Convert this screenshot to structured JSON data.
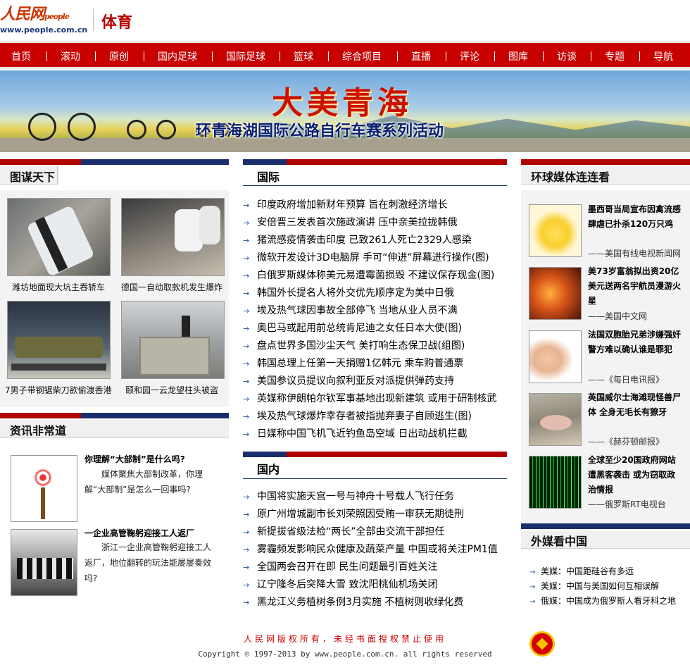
{
  "header": {
    "logo_text": "人民网",
    "logo_small": "people",
    "logo_url": "www.people.com.cn",
    "section_title": "体育"
  },
  "nav": [
    "首页",
    "滚动",
    "原创",
    "国内足球",
    "国际足球",
    "篮球",
    "综合项目",
    "直播",
    "评论",
    "图库",
    "访谈",
    "专题",
    "导航"
  ],
  "banner": {
    "title": "大美青海",
    "subtitle": "环青海湖国际公路自行车赛系列活动"
  },
  "left": {
    "tumou_heading": "图谋天下",
    "photos": [
      {
        "caption": "潍坊地面现大坑主吞轿车"
      },
      {
        "caption": "德国一自动取款机发生爆炸"
      },
      {
        "caption": "7男子带钢锯柴刀欲偷渡香港"
      },
      {
        "caption": "颐和园一云龙望柱头被盗"
      }
    ],
    "zixun_heading": "资讯非常道",
    "zixun": [
      {
        "title": "你理解“大部制”是什么吗?",
        "body": "媒体聚焦大部制改革，你理解“大部制”是怎么一回事吗?"
      },
      {
        "title": "一企业高管鞠躬迎接工人返厂",
        "body": "浙江一企业高管鞠躬迎接工人返厂，地位翻转的玩法能屡屡奏效吗?"
      }
    ]
  },
  "middle": {
    "guoji_heading": "国际",
    "guoji": [
      "印度政府增加新财年预算 旨在刺激经济增长",
      "安倍晋三发表首次施政演讲 压中亲美拉拢韩俄",
      "猪流感疫情袭击印度 已致261人死亡2329人感染",
      "微软开发设计3D电脑屏 手可“伸进”屏幕进行操作(图)",
      "白俄罗斯媒体称美元易遭霉菌损毁 不建议保存现金(图)",
      "韩国外长提名人将外交优先顺序定为美中日俄",
      "埃及热气球因事故全部停飞 当地从业人员不满",
      "奥巴马或起用前总统肯尼迪之女任日本大使(图)",
      "盘点世界多国沙尘天气 美打响生态保卫战(组图)",
      "韩国总理上任第一天捐赠1亿韩元 乘车购普通票",
      "美国参议员提议向叙利亚反对派提供弹药支持",
      "英媒称伊朗帕尔钦军事基地出现新建筑 或用于研制核武",
      "埃及热气球爆炸幸存者被指抛弃妻子自顾逃生(图)",
      "日媒称中国飞机飞近钓鱼岛空域 日出动战机拦截"
    ],
    "guonei_heading": "国内",
    "guonei": [
      "中国将实施天宫一号与神舟十号载人飞行任务",
      "原广州增城副市长刘荣照因受贿一审获无期徒刑",
      "新提拔省级法检“两长”全部由交流干部担任",
      "雾霾频发影响民众健康及蔬菜产量 中国或将关注PM1值",
      "全国两会召开在即 民生问题最引百姓关注",
      "辽宁隆冬后突降大雪 致沈阳桃仙机场关闭",
      "黑龙江义务植树条例3月实施 不植树则收绿化费"
    ]
  },
  "right": {
    "media_heading": "环球媒体连连看",
    "media": [
      {
        "title": "墨西哥当局宣布因禽流感肆虐已扑杀120万只鸡",
        "source": "——美国有线电视新闻网"
      },
      {
        "title": "美73岁富翁拟出资20亿美元送两名宇航员漫游火星",
        "source": "——美国中文网"
      },
      {
        "title": "法国双胞胎兄弟涉嫌强奸 警方难以确认谁是罪犯",
        "source": "——《每日电讯报》"
      },
      {
        "title": "英国威尔士海滩现怪兽尸体 全身无毛长有獠牙",
        "source": "——《赫芬顿邮报》"
      },
      {
        "title": "全球至少20国政府网站遭黑客袭击 或为窃取政治情报",
        "source": "——俄罗斯RT电视台"
      }
    ],
    "waimei_heading": "外媒看中国",
    "waimei": [
      "美媒：中国距硅谷有多远",
      "美媒：中国与美国如何互相误解",
      "俄媒：中国成为俄罗斯人看牙科之地"
    ]
  },
  "footer": {
    "line1": "人民网版权所有，未经书面授权禁止使用",
    "line2": "Copyright © 1997-2013 by www.people.com.cn. all rights reserved"
  },
  "colors": {
    "brand_red": "#c80000",
    "navy": "#1a2e6e"
  }
}
